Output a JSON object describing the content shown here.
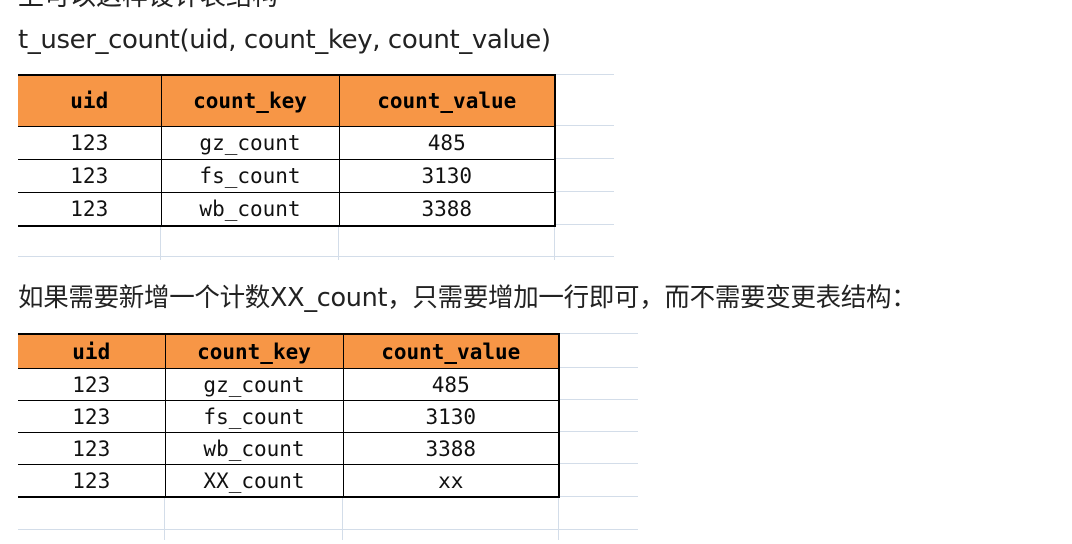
{
  "intro_cut_line": "上可以这样设计表结构",
  "schema_line": "t_user_count(uid, count_key, count_value)",
  "note_line": "如果需要新增一个计数XX_count，只需要增加一行即可，而不需要变更表结构：",
  "table1": {
    "headers": [
      "uid",
      "count_key",
      "count_value"
    ],
    "rows": [
      [
        "123",
        "gz_count",
        "485"
      ],
      [
        "123",
        "fs_count",
        "3130"
      ],
      [
        "123",
        "wb_count",
        "3388"
      ]
    ]
  },
  "table2": {
    "headers": [
      "uid",
      "count_key",
      "count_value"
    ],
    "rows": [
      [
        "123",
        "gz_count",
        "485"
      ],
      [
        "123",
        "fs_count",
        "3130"
      ],
      [
        "123",
        "wb_count",
        "3388"
      ],
      [
        "123",
        "XX_count",
        "xx"
      ]
    ]
  },
  "colors": {
    "header_fill": "#f79646",
    "grid_line": "#d3dde9",
    "border": "#000000"
  }
}
